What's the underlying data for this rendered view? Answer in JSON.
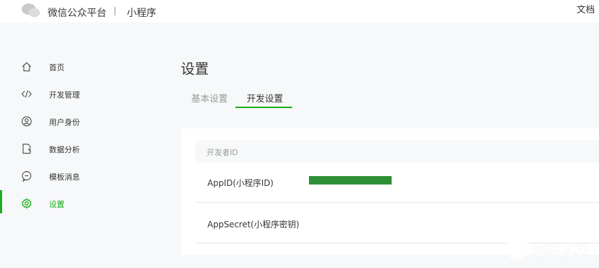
{
  "topbar": {
    "brand": "微信公众平台",
    "separator": "|",
    "product": "小程序",
    "docs_link": "文档"
  },
  "sidebar": {
    "items": [
      {
        "label": "首页",
        "icon": "home-icon",
        "active": false
      },
      {
        "label": "开发管理",
        "icon": "code-icon",
        "active": false
      },
      {
        "label": "用户身份",
        "icon": "user-icon",
        "active": false
      },
      {
        "label": "数据分析",
        "icon": "data-analysis-icon",
        "active": false
      },
      {
        "label": "模板消息",
        "icon": "message-icon",
        "active": false
      },
      {
        "label": "设置",
        "icon": "gear-icon",
        "active": true
      }
    ]
  },
  "main": {
    "title": "设置",
    "tabs": [
      {
        "label": "基本设置",
        "active": false
      },
      {
        "label": "开发设置",
        "active": true
      }
    ],
    "card": {
      "header": "开发者ID",
      "rows": [
        {
          "key": "AppID(小程序ID)",
          "value_redacted": true
        },
        {
          "key": "AppSecret(小程序密钥)"
        }
      ]
    }
  },
  "watermark": {
    "text": "创新互联"
  },
  "colors": {
    "accent": "#1aad19",
    "redaction": "#2f8f36",
    "background": "#f6f8f9"
  }
}
